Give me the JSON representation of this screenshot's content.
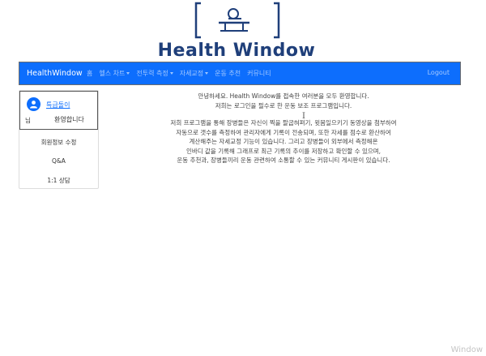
{
  "logo": {
    "text": "Health Window"
  },
  "navbar": {
    "brand": "HealthWindow",
    "items": [
      {
        "label": "홈",
        "dropdown": false
      },
      {
        "label": "헬스 차트",
        "dropdown": true
      },
      {
        "label": "전투력 측정",
        "dropdown": true
      },
      {
        "label": "자세교정",
        "dropdown": true
      },
      {
        "label": "운동 추천",
        "dropdown": false
      },
      {
        "label": "커뮤니티",
        "dropdown": false
      }
    ],
    "logout": "Logout"
  },
  "sidebar": {
    "username": "특급돌이",
    "suffix": "님",
    "welcome": "환영합니다",
    "menu": [
      "회원정보 수정",
      "Q&A",
      "1:1 상담"
    ]
  },
  "main": {
    "lines": [
      "안녕하세요. Health Window를 접속한 여러분을 모두 환영합니다.",
      "저희는 로그인을 필수로 한 운동 보조 프로그램입니다.",
      "",
      "저희 프로그램을 통해 장병들은 자신이 찍을 팔굽혀펴기, 윗몸일으키기 동영상을 첨부하여",
      "자동으로 갯수를 측정하여 관리자에게 기록이 전송되며, 또한 자세를 점수로 환산하여",
      "계산해주는 자세교정 기능이 있습니다. 그리고 장병들이 외부에서 측정해온",
      "인바디 값을 기록해 그래프로 최근 기록의 추이를 저장하고 확인할 수 있으며,",
      "운동 추천과, 장병들끼리 운동 관련하여 소통할 수 있는 커뮤니티 게시판이 있습니다."
    ]
  },
  "watermark": "Window",
  "colors": {
    "primary": "#0d6efd",
    "logo_text": "#1f3f7a"
  }
}
